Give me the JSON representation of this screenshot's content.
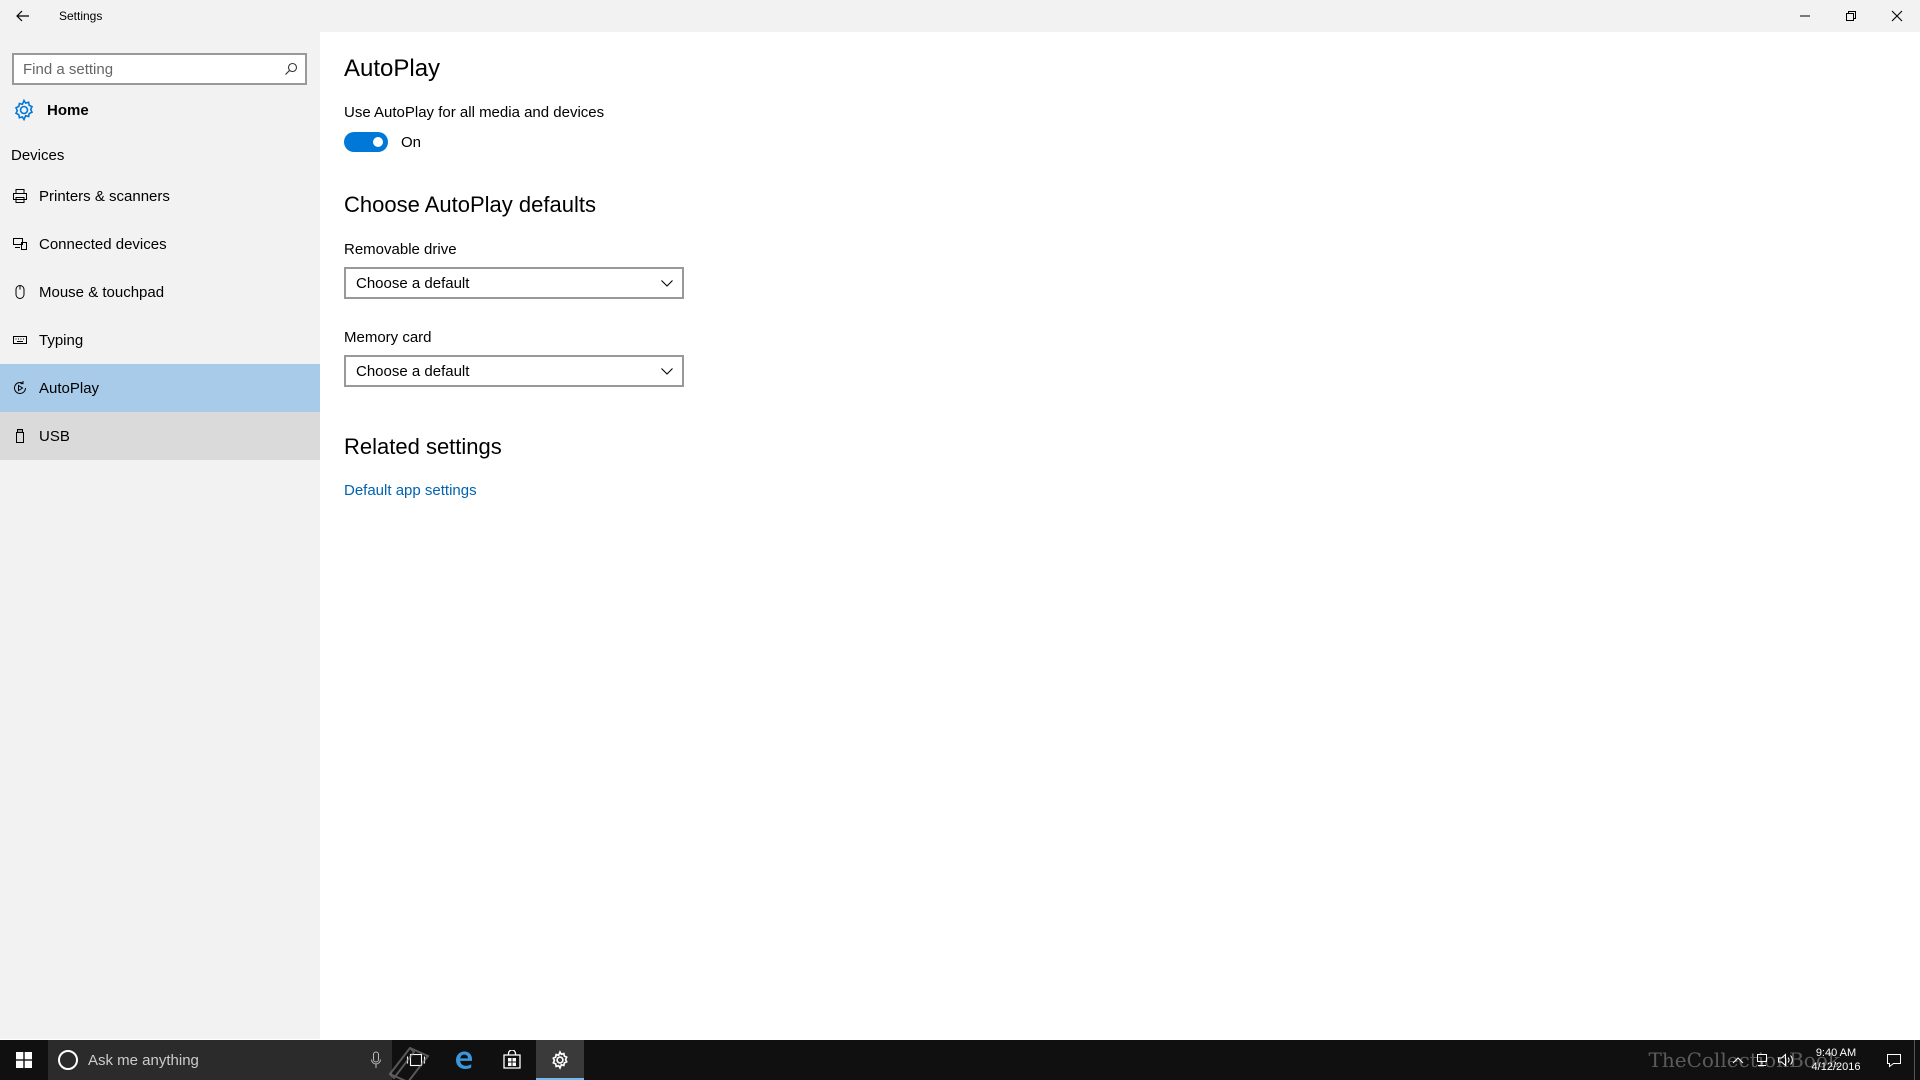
{
  "window": {
    "title": "Settings"
  },
  "sidebar": {
    "search_placeholder": "Find a setting",
    "home_label": "Home",
    "section_label": "Devices",
    "items": [
      {
        "label": "Printers & scanners",
        "icon": "printer-icon"
      },
      {
        "label": "Connected devices",
        "icon": "connected-devices-icon"
      },
      {
        "label": "Mouse & touchpad",
        "icon": "mouse-icon"
      },
      {
        "label": "Typing",
        "icon": "keyboard-icon"
      },
      {
        "label": "AutoPlay",
        "icon": "autoplay-icon",
        "selected": true
      },
      {
        "label": "USB",
        "icon": "usb-icon",
        "hovered": true
      }
    ]
  },
  "main": {
    "title": "AutoPlay",
    "toggle_label": "Use AutoPlay for all media and devices",
    "toggle_state": "On",
    "defaults_heading": "Choose AutoPlay defaults",
    "removable_drive_label": "Removable drive",
    "removable_drive_value": "Choose a default",
    "memory_card_label": "Memory card",
    "memory_card_value": "Choose a default",
    "related_heading": "Related settings",
    "related_link": "Default app settings"
  },
  "taskbar": {
    "search_placeholder": "Ask me anything",
    "time": "9:40 AM",
    "date": "4/12/2016",
    "watermark": "TheCollectionBook"
  },
  "colors": {
    "accent": "#0078d7",
    "link": "#0063b1",
    "selected_bg": "#a7cbe9",
    "sidebar_bg": "#f2f2f2",
    "taskbar_bg": "#101010"
  }
}
